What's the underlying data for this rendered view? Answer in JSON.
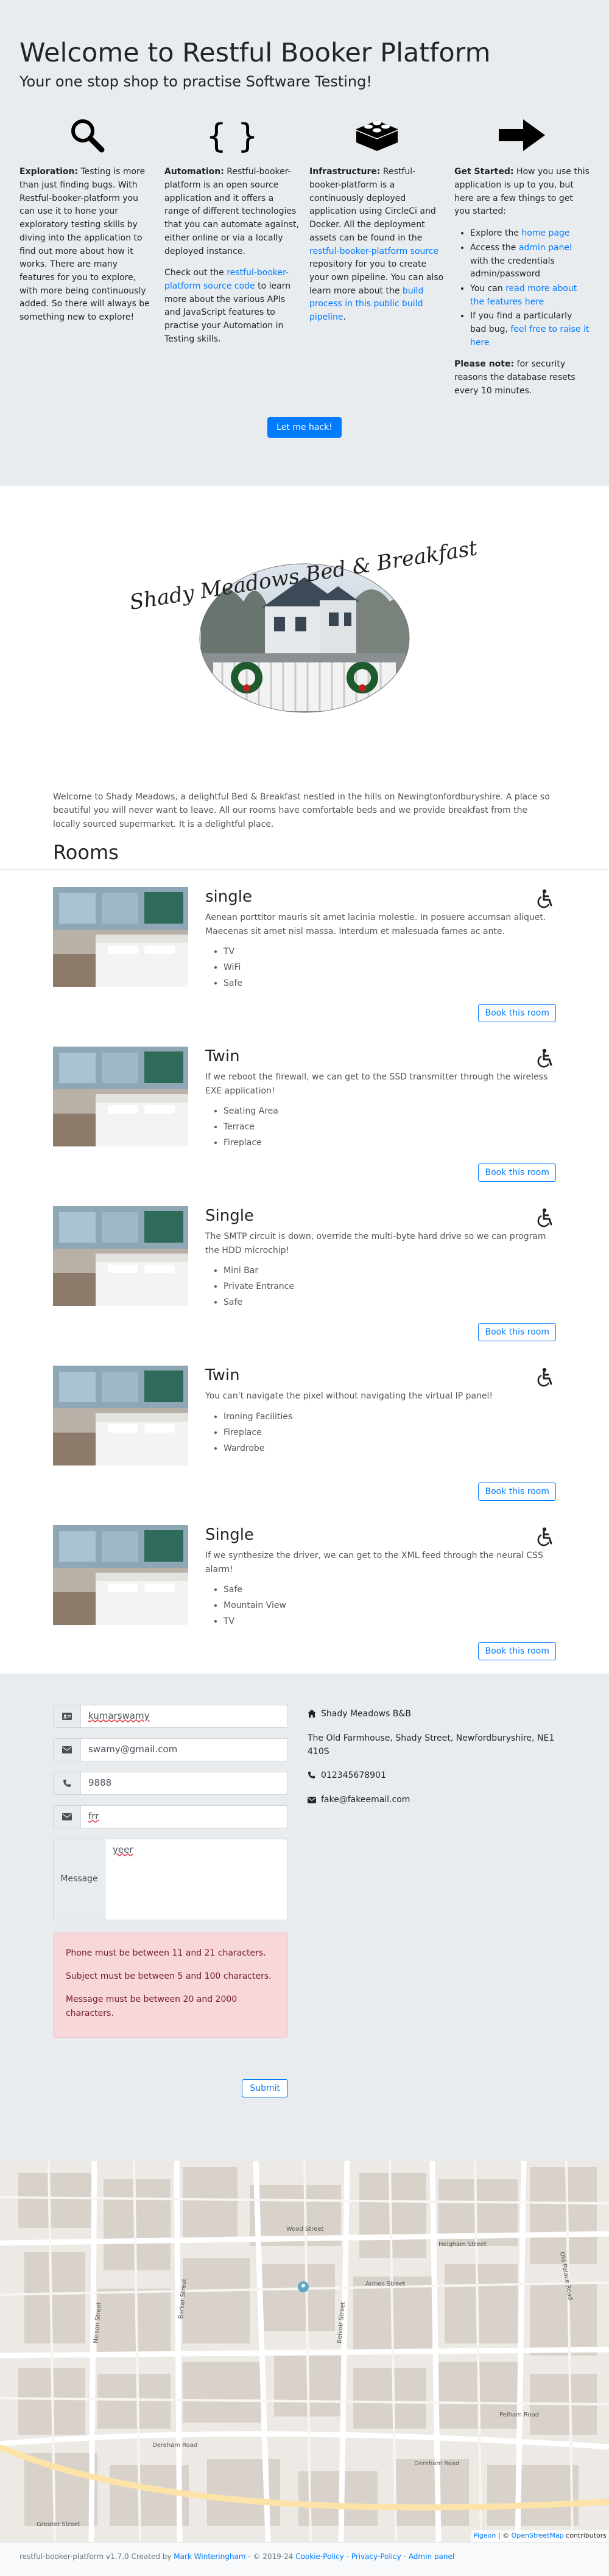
{
  "hero": {
    "title": "Welcome to Restful Booker Platform",
    "subtitle": "Your one stop shop to practise Software Testing!",
    "exploration": {
      "heading": "Exploration:",
      "text": " Testing is more than just finding bugs. With Restful-booker-platform you can use it to hone your exploratory testing skills by diving into the application to find out more about how it works. There are many features for you to explore, with more being continuously added. So there will always be something new to explore!"
    },
    "automation": {
      "heading": "Automation:",
      "text": " Restful-booker-platform is an open source application and it offers a range of different technologies that you can automate against, either online or via a locally deployed instance.",
      "p2_before": "Check out the ",
      "p2_link": "restful-booker-platform source code",
      "p2_after": " to learn more about the various APIs and JavaScript features to practise your Automation in Testing skills."
    },
    "infrastructure": {
      "heading": "Infrastructure:",
      "text1": " Restful-booker-platform is a continuously deployed application using CircleCi and Docker. All the deployment assets can be found in the ",
      "link1": "restful-booker-platform source",
      "text2": " repository for you to create your own pipeline. You can also learn more about the ",
      "link2": "build process in this public build pipeline",
      "text3": "."
    },
    "getstarted": {
      "heading": "Get Started:",
      "text": " How you use this application is up to you, but here are a few things to get you started:",
      "item1_before": "Explore the ",
      "item1_link": "home page",
      "item2_before": "Access the ",
      "item2_link": "admin panel",
      "item2_after": " with the credentials admin/password",
      "item3_before": "You can ",
      "item3_link": "read more about the features here",
      "item4_before": "If you find a particularly bad bug, ",
      "item4_link": "feel free to raise it here",
      "note_heading": "Please note:",
      "note_text": " for security reasons the database resets every 10 minutes."
    },
    "hack_button": "Let me hack!"
  },
  "hotel": {
    "logo_text": "Shady Meadows Bed & Breakfast",
    "description": "Welcome to Shady Meadows, a delightful Bed & Breakfast nestled in the hills on Newingtonfordburyshire. A place so beautiful you will never want to leave. All our rooms have comfortable beds and we provide breakfast from the locally sourced supermarket. It is a delightful place.",
    "rooms_title": "Rooms"
  },
  "rooms": [
    {
      "type": "single",
      "description": "Aenean porttitor mauris sit amet lacinia molestie. In posuere accumsan aliquet. Maecenas sit amet nisl massa. Interdum et malesuada fames ac ante.",
      "features": [
        "TV",
        "WiFi",
        "Safe"
      ],
      "button": "Book this room"
    },
    {
      "type": "Twin",
      "description": "If we reboot the firewall, we can get to the SSD transmitter through the wireless EXE application!",
      "features": [
        "Seating Area",
        "Terrace",
        "Fireplace"
      ],
      "button": "Book this room"
    },
    {
      "type": "Single",
      "description": "The SMTP circuit is down, override the multi-byte hard drive so we can program the HDD microchip!",
      "features": [
        "Mini Bar",
        "Private Entrance",
        "Safe"
      ],
      "button": "Book this room"
    },
    {
      "type": "Twin",
      "description": "You can't navigate the pixel without navigating the virtual IP panel!",
      "features": [
        "Ironing Facilities",
        "Fireplace",
        "Wardrobe"
      ],
      "button": "Book this room"
    },
    {
      "type": "Single",
      "description": "If we synthesize the driver, we can get to the XML feed through the neural CSS alarm!",
      "features": [
        "Safe",
        "Mountain View",
        "TV"
      ],
      "button": "Book this room"
    }
  ],
  "contact": {
    "name_value": "kumarswamy",
    "email_value": "swamy@gmail.com",
    "phone_value": "9888",
    "subject_value": "frr",
    "message_label": "Message",
    "message_value": "yeer",
    "errors": [
      "Phone must be between 11 and 21 characters.",
      "Subject must be between 5 and 100 characters.",
      "Message must be between 20 and 2000 characters."
    ],
    "submit_label": "Submit",
    "address_name": "Shady Meadows B&B",
    "address_line": "The Old Farmhouse, Shady Street, Newfordburyshire, NE1 410S",
    "phone": "012345678901",
    "email": "fake@fakeemail.com"
  },
  "map": {
    "street_labels": [
      "Wood Street",
      "Dereham Road",
      "Nelson Street",
      "Armes Street",
      "Heigham Street",
      "Dereham Road",
      "Old Palace Road",
      "Barker Street",
      "Belvoir Street",
      "Pelham Road",
      "Greater Street"
    ],
    "attribution_leaflet": "Pigeon",
    "attribution_sep": " | © ",
    "attribution_osm": "OpenStreetMap",
    "attribution_tail": " contributors"
  },
  "footer": {
    "text_before": "restful-booker-platform v1.7.0 Created by ",
    "author": "Mark Winteringham",
    "text_mid": " - © 2019-24 ",
    "cookie": "Cookie-Policy",
    "sep1": " - ",
    "privacy": "Privacy-Policy",
    "sep2": " - ",
    "admin": "Admin panel"
  },
  "colors": {
    "primary": "#007bff",
    "hero_bg": "#e9ecef",
    "alert_bg": "#f8d7da",
    "alert_text": "#721c24"
  },
  "icons": {
    "exploration": "magnifying-glass-icon",
    "automation": "curly-braces-icon",
    "infrastructure": "lego-brick-icon",
    "getstarted": "arrow-right-icon",
    "accessible": "wheelchair-icon"
  }
}
